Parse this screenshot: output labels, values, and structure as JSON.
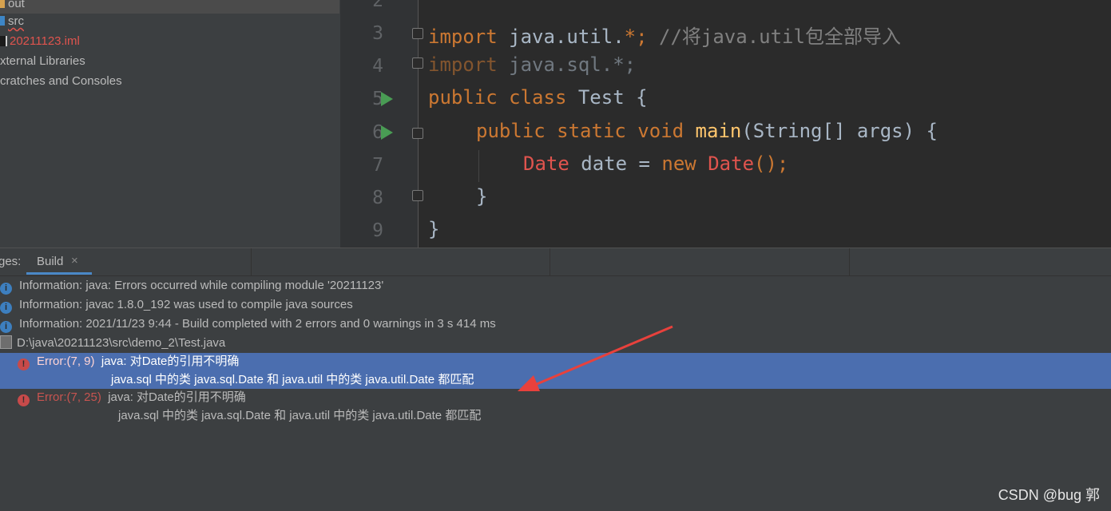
{
  "project_tree": {
    "items": [
      {
        "label": "out"
      },
      {
        "label": "src"
      },
      {
        "label": "20211123.iml"
      },
      {
        "label": "xternal Libraries"
      },
      {
        "label": "cratches and Consoles"
      }
    ]
  },
  "editor": {
    "line_numbers": [
      "2",
      "3",
      "4",
      "5",
      "6",
      "7",
      "8",
      "9"
    ],
    "code": {
      "l3_kw": "import",
      "l3_rest": " java.util.",
      "l3_star": "*;",
      "l3_comment": " //将java.util包全部导入",
      "l4_kw": "import",
      "l4_rest": " java.sql.*;",
      "l5_kw": "public class",
      "l5_rest": " Test {",
      "l6_kw": "public static void",
      "l6_fn": " main",
      "l6_rest": "(String[] args) {",
      "l7_type": "Date",
      "l7_var": " date",
      "l7_eq": " = ",
      "l7_new": "new",
      "l7_ctor": " Date",
      "l7_end": "();",
      "l8": "}",
      "l9": "}"
    }
  },
  "build": {
    "header_label": "ges:",
    "tab_label": "Build",
    "tab_close": "×",
    "messages": [
      "Information: java: Errors occurred while compiling module '20211123'",
      "Information: javac 1.8.0_192 was used to compile java sources",
      "Information: 2021/11/23 9:44 - Build completed with 2 errors and 0 warnings in 3 s 414 ms"
    ],
    "file_path": "D:\\java\\20211123\\src\\demo_2\\Test.java",
    "errors": [
      {
        "location": "Error:(7, 9)",
        "message": "java: 对Date的引用不明确",
        "detail": "java.sql 中的类 java.sql.Date 和 java.util 中的类 java.util.Date 都匹配"
      },
      {
        "location": "Error:(7, 25)",
        "message": "java: 对Date的引用不明确",
        "detail": "java.sql 中的类 java.sql.Date 和 java.util 中的类 java.util.Date 都匹配"
      }
    ]
  },
  "watermark": "CSDN @bug 郭",
  "colors": {
    "arrow": "#e8413c",
    "selection": "#4b6eaf",
    "keyword": "#cc7832",
    "error": "#e0544e"
  }
}
